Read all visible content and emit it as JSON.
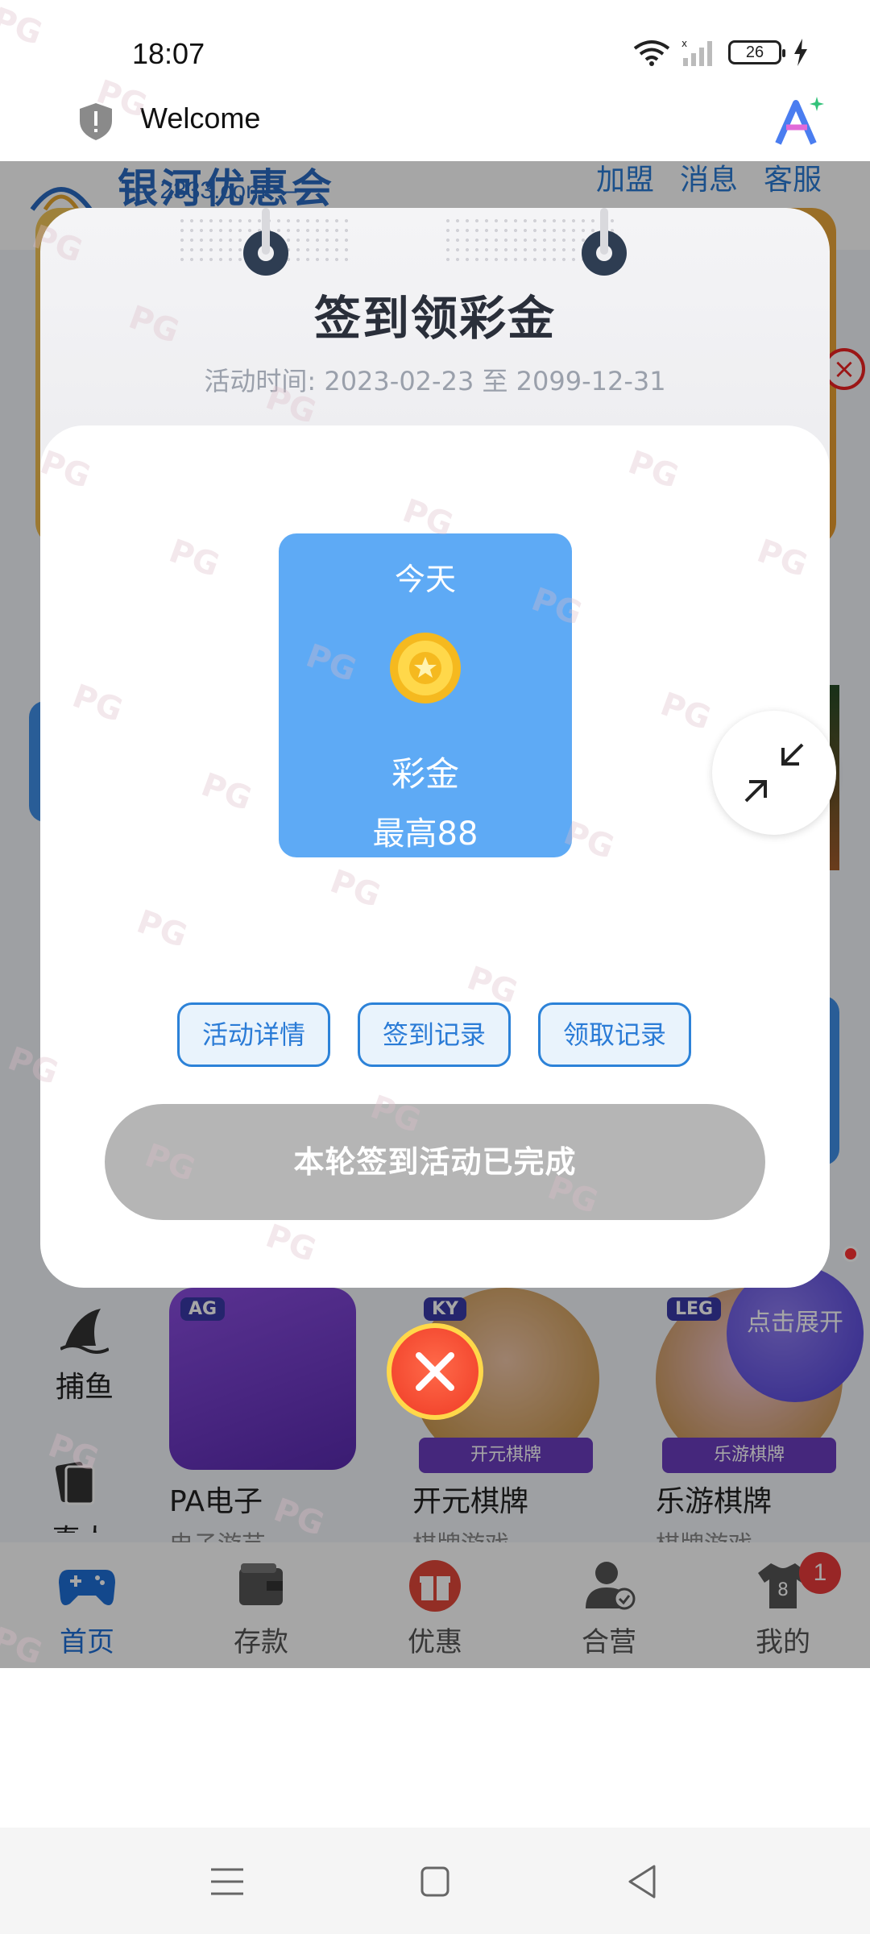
{
  "status_bar": {
    "time": "18:07",
    "battery": "26"
  },
  "browser": {
    "title": "Welcome"
  },
  "app": {
    "brand": {
      "name": "银河优惠会",
      "domain": "— 2333.com —"
    },
    "header_links": [
      "加盟",
      "消息",
      "客服"
    ],
    "categories": [
      {
        "label": "捕鱼"
      },
      {
        "label": "真人"
      }
    ],
    "games": [
      {
        "name": "PA电子",
        "sub": "电子游艺",
        "tag": "AG",
        "ribbon": ""
      },
      {
        "name": "开元棋牌",
        "sub": "棋牌游戏",
        "tag": "KY",
        "ribbon": "开元棋牌"
      },
      {
        "name": "乐游棋牌",
        "sub": "棋牌游戏",
        "tag": "LEG",
        "ribbon": "乐游棋牌"
      }
    ],
    "expand_label": "点击展开",
    "bottom_nav": [
      {
        "label": "首页",
        "icon": "gamepad-icon",
        "active": true
      },
      {
        "label": "存款",
        "icon": "wallet-icon",
        "active": false
      },
      {
        "label": "优惠",
        "icon": "gift-icon",
        "active": false
      },
      {
        "label": "合营",
        "icon": "user-check-icon",
        "active": false
      },
      {
        "label": "我的",
        "icon": "shirt-icon",
        "active": false,
        "badge": "1"
      }
    ]
  },
  "modal": {
    "title": "签到领彩金",
    "subtitle": "活动时间: 2023-02-23 至 2099-12-31",
    "day_card": {
      "day": "今天",
      "reward_label": "彩金",
      "reward_max": "最高88"
    },
    "buttons": {
      "details": "活动详情",
      "checkin_records": "签到记录",
      "claim_records": "领取记录"
    },
    "done_button": "本轮签到活动已完成"
  },
  "watermark_text": "PG",
  "colors": {
    "accent": "#2a7bd6",
    "card_blue": "#5eaaf5",
    "done_gray": "#b5b5b5",
    "badge_red": "#ea3b3b"
  }
}
